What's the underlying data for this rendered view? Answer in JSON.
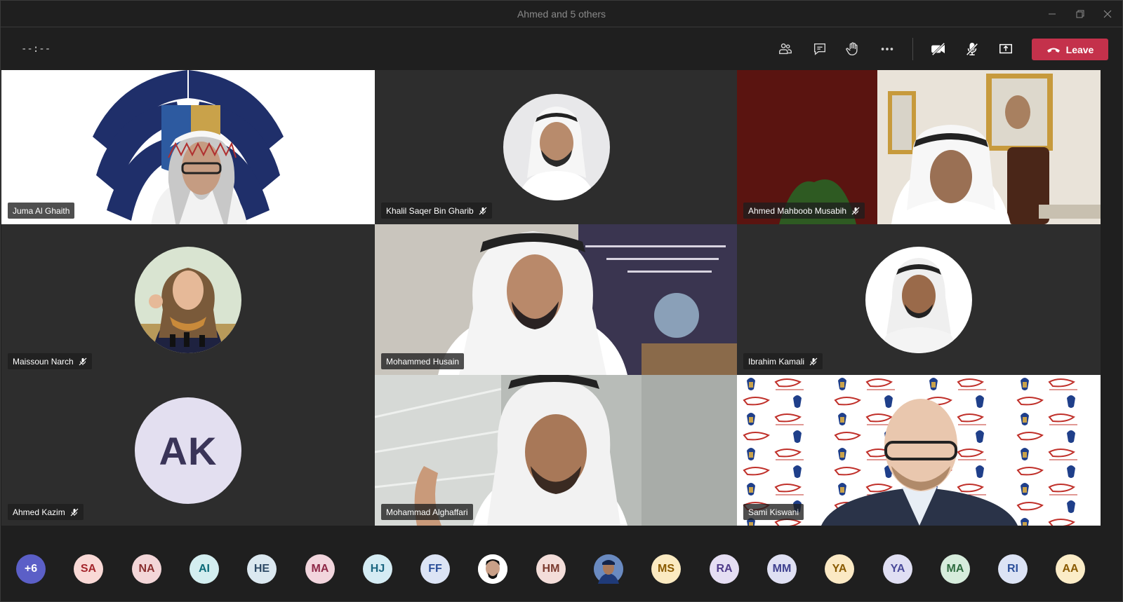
{
  "window": {
    "title": "Ahmed and 5 others",
    "controls": [
      "minimize-icon",
      "restore-icon",
      "close-icon"
    ]
  },
  "toolbar": {
    "timer": "--:--",
    "buttons": [
      "participants-icon",
      "chat-icon",
      "raise-hand-icon",
      "more-options-icon",
      "camera-off-icon",
      "mic-muted-icon",
      "share-screen-icon"
    ],
    "leave_label": "Leave",
    "leave_color": "#c4314b"
  },
  "tiles": [
    {
      "name": "Juma Al Ghaith",
      "muted": false
    },
    {
      "name": "Khalil Saqer Bin Gharib",
      "muted": true
    },
    {
      "name": "Ahmed Mahboob Musabih",
      "muted": true
    },
    {
      "name": "Maissoun Narch",
      "muted": true
    },
    {
      "name": "Mohammed Husain",
      "muted": false
    },
    {
      "name": "Ibrahim Kamali",
      "muted": true
    },
    {
      "name": "Ahmed Kazim",
      "muted": true,
      "initials": "AK"
    },
    {
      "name": "Mohammad Alghaffari",
      "muted": false
    },
    {
      "name": "Sami Kiswani",
      "muted": false
    }
  ],
  "attendees": [
    {
      "label": "+6",
      "bg": "#5b5fc7",
      "fg": "#ffffff"
    },
    {
      "label": "SA",
      "bg": "#f9d9d6",
      "fg": "#a4262c"
    },
    {
      "label": "NA",
      "bg": "#f3d6d8",
      "fg": "#8a3030"
    },
    {
      "label": "AI",
      "bg": "#d3eef0",
      "fg": "#0b6a78"
    },
    {
      "label": "HE",
      "bg": "#dbe8f0",
      "fg": "#2e4a66"
    },
    {
      "label": "MA",
      "bg": "#f2d5dd",
      "fg": "#8e2847"
    },
    {
      "label": "HJ",
      "bg": "#d5ecf4",
      "fg": "#1b6680"
    },
    {
      "label": "FF",
      "bg": "#dce4f5",
      "fg": "#2c4f9a"
    },
    {
      "label": "",
      "bg": "#ffffff",
      "fg": "#000000",
      "photo": true
    },
    {
      "label": "HM",
      "bg": "#f3ddd9",
      "fg": "#7a3a2e"
    },
    {
      "label": "",
      "bg": "#3a5a9a",
      "fg": "#ffffff",
      "photo": true
    },
    {
      "label": "MS",
      "bg": "#fbeac1",
      "fg": "#8a5a00"
    },
    {
      "label": "RA",
      "bg": "#e5def3",
      "fg": "#4f3b8a"
    },
    {
      "label": "MM",
      "bg": "#dfe0f3",
      "fg": "#3f418f"
    },
    {
      "label": "YA",
      "bg": "#fbe9c4",
      "fg": "#8a5a00"
    },
    {
      "label": "YA",
      "bg": "#e0dff3",
      "fg": "#4a4a9a"
    },
    {
      "label": "MA",
      "bg": "#d6ecdc",
      "fg": "#2e6b3f"
    },
    {
      "label": "RI",
      "bg": "#dce3f5",
      "fg": "#2c4f9a"
    },
    {
      "label": "AA",
      "bg": "#fbecc7",
      "fg": "#8a5a00"
    }
  ]
}
